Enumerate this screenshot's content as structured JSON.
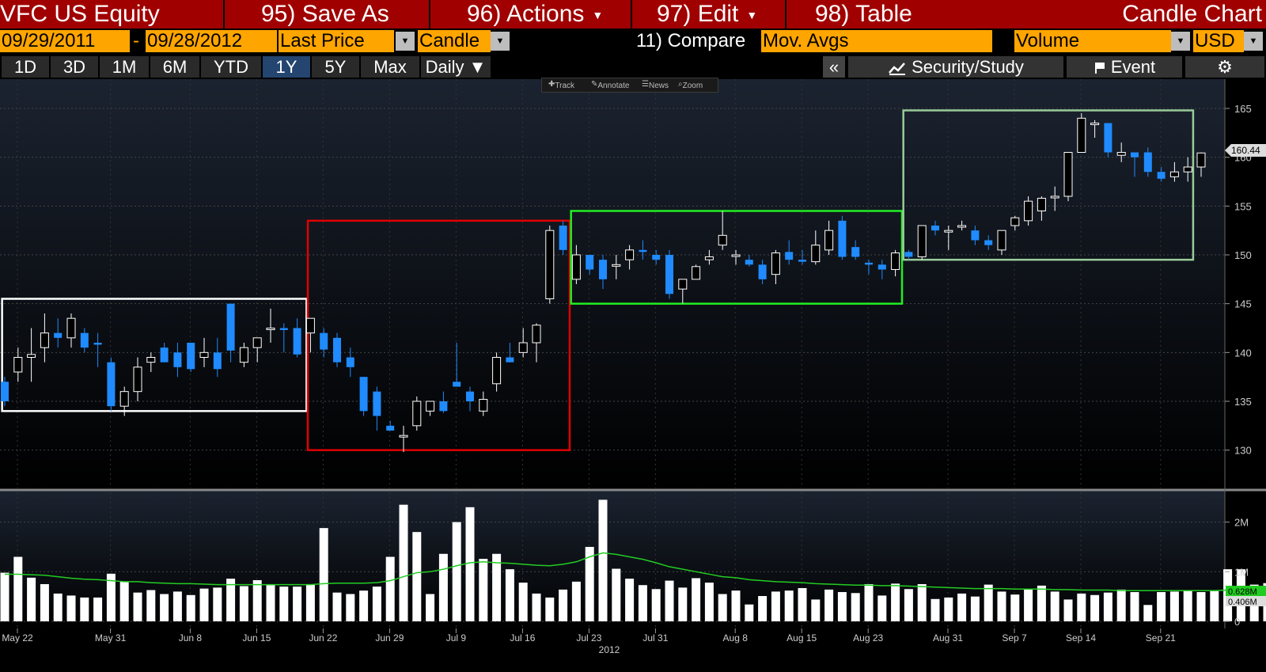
{
  "header": {
    "security": "VFC US Equity",
    "save_as": "95) Save As",
    "actions": "96) Actions",
    "edit": "97) Edit",
    "table": "98) Table",
    "chart_type_title": "Candle Chart"
  },
  "controls": {
    "start_date": "09/29/2011",
    "dash": "-",
    "end_date": "09/28/2012",
    "field": "Last Price",
    "style": "Candle",
    "compare": "11) Compare",
    "mov_avgs": "Mov. Avgs",
    "lower_study": "Volume",
    "currency": "USD"
  },
  "tabs": [
    {
      "label": "1D"
    },
    {
      "label": "3D"
    },
    {
      "label": "1M"
    },
    {
      "label": "6M"
    },
    {
      "label": "YTD"
    },
    {
      "label": "1Y"
    },
    {
      "label": "5Y"
    },
    {
      "label": "Max"
    }
  ],
  "selected_tab": "1Y",
  "period": "Daily ▼",
  "collapse_glyph": "«",
  "security_study": "Security/Study",
  "event": "Event",
  "gear_glyph": "⚙",
  "toolbar": {
    "track": "Track",
    "annotate": "Annotate",
    "news": "News",
    "zoom": "Zoom"
  },
  "colors": {
    "up_candle": "#ffffff",
    "down_candle": "#1f8bff",
    "box_white": "#ffffff",
    "box_red": "#e00000",
    "box_green": "#22ee22",
    "box_lightgreen": "#99cc99",
    "volume_ma": "#22cc22",
    "grid": "#444444",
    "background": "#0a0e14"
  },
  "chart_data": [
    {
      "type": "candlestick",
      "x_labels": [
        "May 22",
        "May 31",
        "Jun 8",
        "Jun 15",
        "Jun 22",
        "Jun 29",
        "Jul 9",
        "Jul 16",
        "Jul 23",
        "Jul 31",
        "Aug 8",
        "Aug 15",
        "Aug 23",
        "Aug 31",
        "Sep 7",
        "Sep 14",
        "Sep 21"
      ],
      "year_label": "2012",
      "y_ticks": [
        130,
        135,
        140,
        145,
        150,
        155,
        160,
        165
      ],
      "ylim": [
        126,
        168
      ],
      "last_price_label": "160.44",
      "ohlc": [
        [
          137,
          137.5,
          134.5,
          135
        ],
        [
          138,
          140.5,
          137,
          139.5
        ],
        [
          139.5,
          142.5,
          137,
          139.8
        ],
        [
          140.5,
          144,
          139,
          142
        ],
        [
          142,
          143.5,
          140.5,
          141.5
        ],
        [
          141.5,
          144,
          140.5,
          143.5
        ],
        [
          142,
          142.5,
          140,
          140.5
        ],
        [
          141,
          142,
          138.5,
          140.8
        ],
        [
          139,
          139.5,
          134,
          134.5
        ],
        [
          134.5,
          136.5,
          133.5,
          136
        ],
        [
          136,
          139.5,
          135,
          138.5
        ],
        [
          139,
          140,
          138,
          139.5
        ],
        [
          140.5,
          141,
          139,
          139
        ],
        [
          140,
          141,
          137.5,
          138.5
        ],
        [
          141,
          141,
          138,
          138.3
        ],
        [
          139.5,
          141.5,
          138.5,
          140
        ],
        [
          140,
          141.5,
          137.5,
          138.3
        ],
        [
          145,
          145,
          139,
          140.2
        ],
        [
          139,
          141,
          138.5,
          140.5
        ],
        [
          140.5,
          141.5,
          139,
          141.5
        ],
        [
          142.5,
          144.5,
          141,
          142.5
        ],
        [
          142.5,
          143,
          140,
          142.3
        ],
        [
          142.5,
          143.5,
          139.5,
          139.8
        ],
        [
          142,
          143.5,
          140,
          143.5
        ],
        [
          142,
          142.5,
          139.5,
          140.3
        ],
        [
          141.5,
          142,
          138.5,
          139
        ],
        [
          139.5,
          140.5,
          137.5,
          138.5
        ],
        [
          137.5,
          137.5,
          133.5,
          134
        ],
        [
          136,
          136.5,
          132,
          133.5
        ],
        [
          132.5,
          133,
          132,
          132
        ],
        [
          131.5,
          132.5,
          129.8,
          131.5
        ],
        [
          132.5,
          135.5,
          132,
          135
        ],
        [
          134,
          135,
          133.5,
          135
        ],
        [
          135,
          136,
          133.8,
          134
        ],
        [
          137,
          141,
          136.5,
          136.5
        ],
        [
          136,
          136.5,
          134,
          135
        ],
        [
          134,
          136,
          133.5,
          135.2
        ],
        [
          136.8,
          140,
          136,
          139.5
        ],
        [
          139.5,
          141,
          139,
          139
        ],
        [
          140,
          142.5,
          139.5,
          141
        ],
        [
          141,
          143,
          139,
          142.8
        ],
        [
          145.5,
          153,
          145,
          152.5
        ],
        [
          153,
          153.5,
          150,
          150.5
        ],
        [
          147.5,
          151,
          147,
          150
        ],
        [
          150,
          150,
          148,
          148.5
        ],
        [
          149.5,
          150,
          146.5,
          147.5
        ],
        [
          149,
          150,
          147.5,
          149
        ],
        [
          149.5,
          151,
          148.5,
          150.5
        ],
        [
          150.5,
          151.5,
          149.5,
          150.3
        ],
        [
          150,
          150.5,
          149,
          149.5
        ],
        [
          150,
          150.5,
          145.5,
          146
        ],
        [
          146.5,
          147,
          145,
          147.5
        ],
        [
          147.5,
          149,
          147.5,
          148.8
        ],
        [
          149.5,
          150.5,
          149,
          149.8
        ],
        [
          151,
          154.5,
          150.5,
          152
        ],
        [
          150,
          150.5,
          149,
          150
        ],
        [
          149.5,
          150,
          148.8,
          149
        ],
        [
          149,
          149.5,
          147,
          147.5
        ],
        [
          148,
          150.5,
          147,
          150.2
        ],
        [
          150.3,
          151.5,
          149,
          149.5
        ],
        [
          149.5,
          150.5,
          149,
          149.3
        ],
        [
          149.3,
          152.5,
          149,
          151
        ],
        [
          150.5,
          153.5,
          150,
          152.5
        ],
        [
          153.5,
          154,
          149.5,
          149.8
        ],
        [
          150.8,
          151.5,
          149.5,
          149.8
        ],
        [
          149.2,
          149.5,
          148,
          149
        ],
        [
          149,
          149.5,
          147.5,
          148.5
        ],
        [
          148.5,
          150.5,
          147.8,
          150.2
        ],
        [
          150.3,
          150.5,
          149.5,
          149.8
        ],
        [
          149.8,
          153,
          149.5,
          153
        ],
        [
          153,
          153.5,
          152,
          152.5
        ],
        [
          152.5,
          153,
          150.5,
          152.5
        ],
        [
          153,
          153.5,
          152.5,
          153
        ],
        [
          152.5,
          153,
          151,
          151.5
        ],
        [
          151.5,
          152,
          150.5,
          151
        ],
        [
          150.5,
          152.5,
          150,
          152.5
        ],
        [
          153,
          154,
          152.5,
          153.8
        ],
        [
          153.5,
          156,
          153,
          155.5
        ],
        [
          154.5,
          156,
          153.5,
          155.8
        ],
        [
          156,
          157,
          154.5,
          156
        ],
        [
          156,
          160.5,
          155.5,
          160.5
        ],
        [
          160.5,
          164.5,
          160.5,
          164
        ],
        [
          163.5,
          163.8,
          162,
          163.5
        ],
        [
          163.5,
          163.5,
          160,
          160.5
        ],
        [
          160.2,
          161.5,
          159.5,
          160.5
        ],
        [
          160.5,
          160.5,
          158,
          160
        ],
        [
          160.5,
          161,
          158,
          158.5
        ],
        [
          158.5,
          159,
          157.5,
          157.8
        ],
        [
          158,
          159.5,
          157.5,
          158.5
        ],
        [
          158.5,
          160,
          157.5,
          159
        ],
        [
          159,
          160.5,
          158,
          160.44
        ]
      ]
    },
    {
      "type": "bar",
      "name": "Volume",
      "y_ticks_labels": [
        "0",
        "1M",
        "2M"
      ],
      "ylim": [
        0,
        2.6
      ],
      "ma_label": "0.628M",
      "last_volume_label": "0.406M",
      "values": [
        0.98,
        1.3,
        0.88,
        0.75,
        0.56,
        0.52,
        0.48,
        0.48,
        0.96,
        0.8,
        0.58,
        0.63,
        0.55,
        0.6,
        0.53,
        0.66,
        0.68,
        0.86,
        0.71,
        0.83,
        0.73,
        0.7,
        0.7,
        0.75,
        1.88,
        0.58,
        0.55,
        0.62,
        0.7,
        1.3,
        2.35,
        1.8,
        0.55,
        1.36,
        2.0,
        2.3,
        1.26,
        1.36,
        1.05,
        0.78,
        0.56,
        0.48,
        0.64,
        0.8,
        1.5,
        2.45,
        1.06,
        0.86,
        0.73,
        0.65,
        0.82,
        0.68,
        0.87,
        0.78,
        0.55,
        0.62,
        0.34,
        0.51,
        0.6,
        0.62,
        0.67,
        0.44,
        0.64,
        0.59,
        0.57,
        0.75,
        0.52,
        0.76,
        0.65,
        0.75,
        0.45,
        0.48,
        0.56,
        0.5,
        0.74,
        0.6,
        0.54,
        0.64,
        0.72,
        0.6,
        0.44,
        0.56,
        0.53,
        0.58,
        0.64,
        0.59,
        0.33,
        0.59,
        0.6,
        0.62,
        0.59,
        0.61,
        1.05,
        1.05,
        0.74,
        0.77
      ],
      "moving_average": [
        0.95,
        0.95,
        0.94,
        0.93,
        0.9,
        0.87,
        0.85,
        0.84,
        0.82,
        0.8,
        0.8,
        0.78,
        0.77,
        0.76,
        0.76,
        0.75,
        0.74,
        0.74,
        0.74,
        0.74,
        0.74,
        0.74,
        0.74,
        0.74,
        0.76,
        0.77,
        0.77,
        0.77,
        0.78,
        0.82,
        0.9,
        0.98,
        1.0,
        1.05,
        1.12,
        1.18,
        1.2,
        1.18,
        1.17,
        1.15,
        1.13,
        1.12,
        1.15,
        1.2,
        1.3,
        1.38,
        1.35,
        1.3,
        1.25,
        1.18,
        1.1,
        1.05,
        1.0,
        0.95,
        0.9,
        0.88,
        0.84,
        0.82,
        0.8,
        0.79,
        0.78,
        0.76,
        0.75,
        0.74,
        0.73,
        0.73,
        0.72,
        0.72,
        0.71,
        0.7,
        0.69,
        0.68,
        0.67,
        0.66,
        0.66,
        0.66,
        0.65,
        0.65,
        0.65,
        0.64,
        0.64,
        0.63,
        0.63,
        0.63,
        0.62,
        0.62,
        0.62,
        0.62,
        0.62,
        0.62,
        0.62,
        0.62,
        0.63,
        0.64,
        0.64,
        0.64
      ]
    }
  ]
}
